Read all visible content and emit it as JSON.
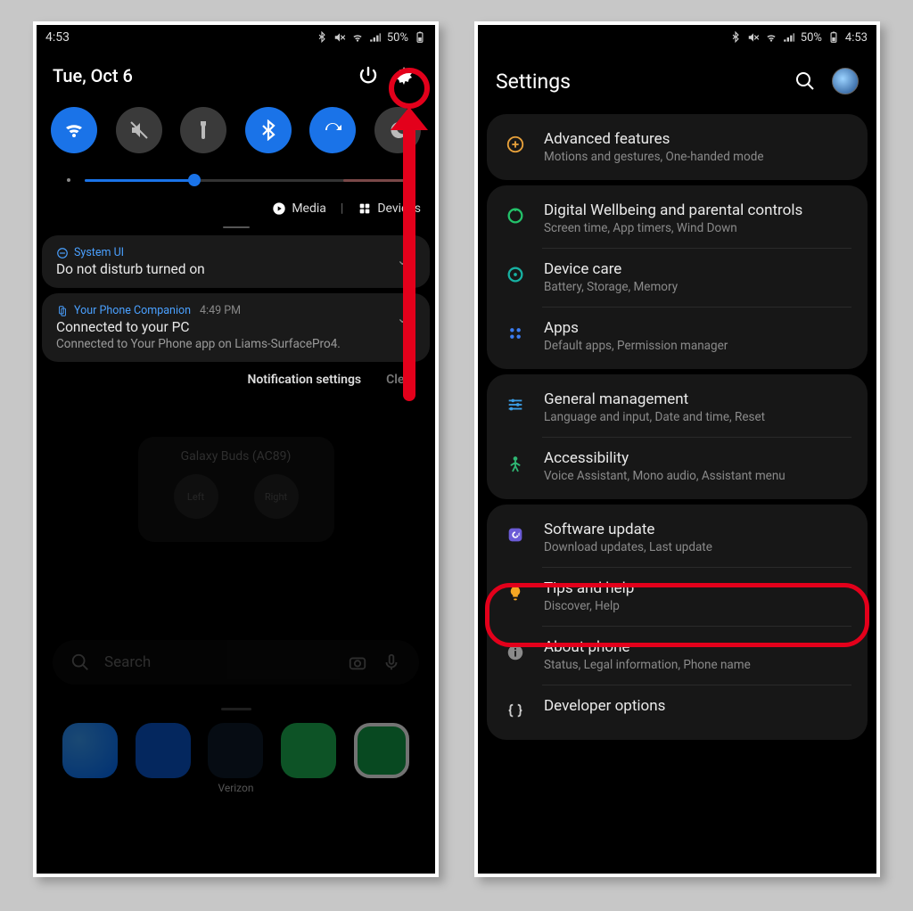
{
  "left": {
    "status": {
      "time": "4:53",
      "battery": "50%"
    },
    "date": "Tue, Oct 6",
    "slider": {
      "percent": 34
    },
    "media_label": "Media",
    "devices_label": "Devices",
    "notifications": [
      {
        "app": "System UI",
        "title": "Do not disturb turned on"
      },
      {
        "app": "Your Phone Companion",
        "time": "4:49 PM",
        "title": "Connected to your PC",
        "body": "Connected to Your Phone app on Liams-SurfacePro4."
      }
    ],
    "actions": {
      "settings": "Notification settings",
      "clear": "Clear"
    },
    "buds": {
      "name": "Galaxy Buds (AC89)",
      "left": "Left",
      "right": "Right"
    },
    "search_placeholder": "Search",
    "carrier": "Verizon"
  },
  "right": {
    "status": {
      "time": "4:53",
      "battery": "50%"
    },
    "title": "Settings",
    "groups": [
      [
        {
          "key": "advanced",
          "icon": "plus-gear",
          "color": "#e9a23b",
          "title": "Advanced features",
          "sub": "Motions and gestures, One-handed mode"
        }
      ],
      [
        {
          "key": "wellbeing",
          "icon": "ring",
          "color": "#23c26a",
          "title": "Digital Wellbeing and parental controls",
          "sub": "Screen time, App timers, Wind Down"
        },
        {
          "key": "devicecare",
          "icon": "ring-dot",
          "color": "#17b1a2",
          "title": "Device care",
          "sub": "Battery, Storage, Memory"
        },
        {
          "key": "apps",
          "icon": "apps-grid",
          "color": "#3b7cf0",
          "title": "Apps",
          "sub": "Default apps, Permission manager"
        }
      ],
      [
        {
          "key": "general",
          "icon": "sliders",
          "color": "#3b9de4",
          "title": "General management",
          "sub": "Language and input, Date and time, Reset"
        },
        {
          "key": "a11y",
          "icon": "person",
          "color": "#2fb673",
          "title": "Accessibility",
          "sub": "Voice Assistant, Mono audio, Assistant menu"
        }
      ],
      [
        {
          "key": "swupdate",
          "icon": "update",
          "color": "#6b5bd6",
          "title": "Software update",
          "sub": "Download updates, Last update"
        },
        {
          "key": "tips",
          "icon": "bulb",
          "color": "#f5a623",
          "title": "Tips and help",
          "sub": "Discover, Help"
        },
        {
          "key": "about",
          "icon": "info",
          "color": "#8a8a8a",
          "title": "About phone",
          "sub": "Status, Legal information, Phone name"
        },
        {
          "key": "devopts",
          "icon": "braces",
          "color": "#cccccc",
          "title": "Developer options",
          "sub": ""
        }
      ]
    ]
  }
}
